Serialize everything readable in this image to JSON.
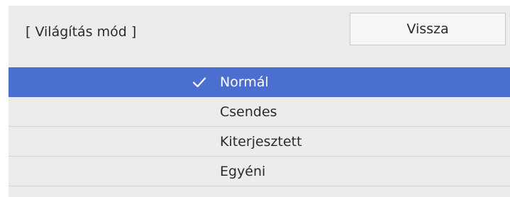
{
  "dialog": {
    "title": "[ Világítás mód ]",
    "back_label": "Vissza"
  },
  "options": [
    {
      "label": "Normál",
      "selected": true
    },
    {
      "label": "Csendes",
      "selected": false
    },
    {
      "label": "Kiterjesztett",
      "selected": false
    },
    {
      "label": "Egyéni",
      "selected": false
    }
  ],
  "colors": {
    "selected_bg": "#4a6fd1",
    "panel_bg": "#ececec",
    "text": "#2b2b2b"
  },
  "icons": {
    "selected_marker": "checkmark-icon"
  }
}
